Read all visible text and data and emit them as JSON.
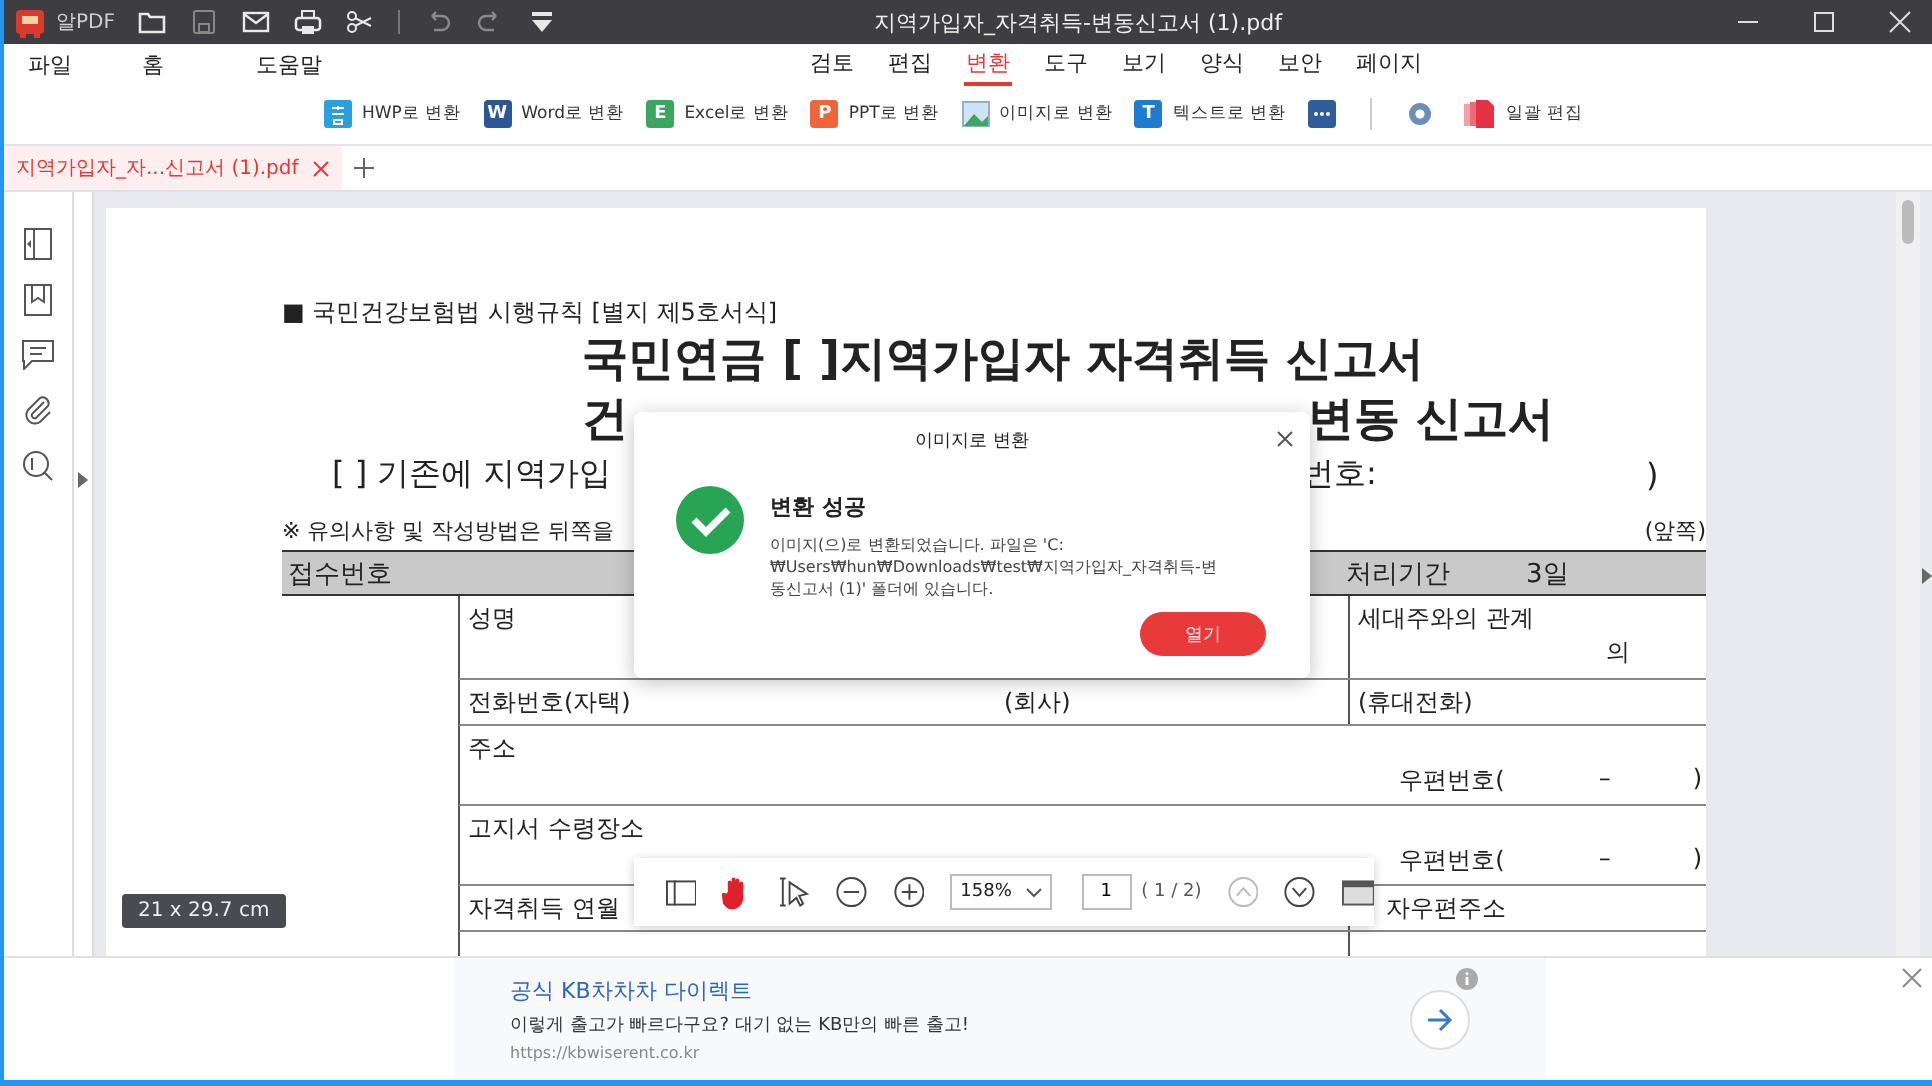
{
  "window": {
    "app_name": "알PDF",
    "title": "지역가입자_자격취득-변동신고서 (1).pdf"
  },
  "quick_tools": [
    {
      "kind": "folder",
      "disabled": false
    },
    {
      "kind": "save",
      "disabled": true
    },
    {
      "kind": "mail",
      "disabled": false
    },
    {
      "kind": "print",
      "disabled": false
    },
    {
      "kind": "scissors",
      "disabled": false
    },
    {
      "kind": "sep"
    },
    {
      "kind": "undo",
      "disabled": true
    },
    {
      "kind": "redo",
      "disabled": true
    },
    {
      "kind": "dropdown",
      "disabled": false
    }
  ],
  "menu": {
    "left": [
      {
        "label": "파일"
      },
      {
        "label": "홈"
      },
      {
        "label": "도움말"
      }
    ],
    "tabs": [
      {
        "label": "검토",
        "selected": false
      },
      {
        "label": "편집",
        "selected": false
      },
      {
        "label": "변환",
        "selected": true
      },
      {
        "label": "도구",
        "selected": false
      },
      {
        "label": "보기",
        "selected": false
      },
      {
        "label": "양식",
        "selected": false
      },
      {
        "label": "보안",
        "selected": false
      },
      {
        "label": "페이지",
        "selected": false
      }
    ]
  },
  "ribbon": [
    {
      "kind": "hwp",
      "label": "HWP로 변환"
    },
    {
      "kind": "word",
      "letter": "W",
      "label": "Word로 변환"
    },
    {
      "kind": "excel",
      "letter": "E",
      "label": "Excel로 변환"
    },
    {
      "kind": "ppt",
      "letter": "P",
      "label": "PPT로 변환"
    },
    {
      "kind": "image",
      "label": "이미지로 변환"
    },
    {
      "kind": "text",
      "letter": "T",
      "label": "텍스트로 변환"
    },
    {
      "kind": "more"
    },
    {
      "kind": "sep"
    },
    {
      "kind": "gear"
    },
    {
      "kind": "batch",
      "label": "일괄 편집"
    }
  ],
  "doc_tabs": [
    {
      "label": "지역가입자_자...신고서 (1).pdf",
      "selected": true
    }
  ],
  "document": {
    "header": "■ 국민건강보험법 시행규칙 [별지 제5호서식]",
    "title": "국민연금 [ ]지역가입자 자격취득 신고서",
    "title_2_parts": [
      "건",
      "변동 신고서"
    ],
    "option_parts": [
      "[ ] 기존에 지역가입",
      "번호:",
      ")"
    ],
    "notice": "※ 유의사항 및 작성방법은 뒤쪽을",
    "side": "(앞쪽)",
    "receipt": {
      "label": "접수번호",
      "period_label": "처리기간",
      "period": "3일"
    },
    "rows": [
      {
        "left": "성명",
        "right": "세대주와의 관계",
        "right_2": "의"
      },
      {
        "left": "전화번호(자택)",
        "middle": "(회사)",
        "right": "(휴대전화)"
      },
      {
        "left": "주소",
        "postal": [
          "우편번호(",
          "–",
          ")"
        ]
      },
      {
        "left": "고지서 수령장소",
        "postal": [
          "우편번호(",
          "–",
          ")"
        ]
      },
      {
        "left": "자격취득 연월",
        "right": "자우편주소"
      }
    ]
  },
  "dialog": {
    "title": "이미지로 변환",
    "heading": "변환 성공",
    "message": "이미지(으)로 변환되었습니다. 파일은 'C:₩Users₩hun₩Downloads₩test₩지역가입자_자격취득-변동신고서 (1)' 폴더에 있습니다.",
    "button": "열기"
  },
  "viewer_toolbar": {
    "zoom": "158%",
    "page": "1",
    "page_count": "( 1 / 2)",
    "nav": [
      {
        "kind": "up",
        "disabled": true
      },
      {
        "kind": "down",
        "disabled": false
      }
    ]
  },
  "page_size": "21 x 29.7 cm",
  "ad": {
    "title": "공식 KB차차차 다이렉트",
    "text": "이렇게 출고가 빠르다구요? 대기 없는 KB만의 빠른 출고!",
    "url": "https://kbwiserent.co.kr"
  }
}
